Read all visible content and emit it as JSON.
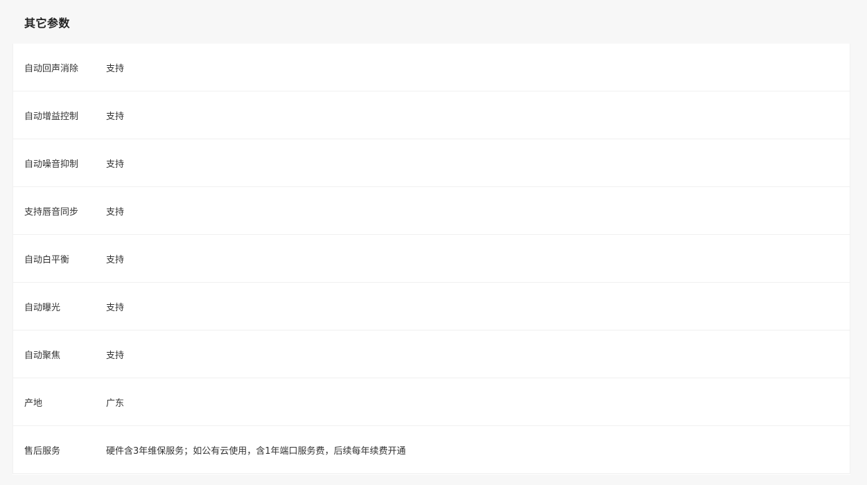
{
  "section": {
    "title": "其它参数"
  },
  "rows": [
    {
      "label": "自动回声消除",
      "value": "支持"
    },
    {
      "label": "自动增益控制",
      "value": "支持"
    },
    {
      "label": "自动噪音抑制",
      "value": "支持"
    },
    {
      "label": "支持唇音同步",
      "value": "支持"
    },
    {
      "label": "自动白平衡",
      "value": "支持"
    },
    {
      "label": "自动曝光",
      "value": "支持"
    },
    {
      "label": "自动聚焦",
      "value": "支持"
    },
    {
      "label": "产地",
      "value": "广东"
    },
    {
      "label": "售后服务",
      "value": "硬件含3年维保服务；如公有云使用，含1年端口服务费，后续每年续费开通"
    }
  ]
}
